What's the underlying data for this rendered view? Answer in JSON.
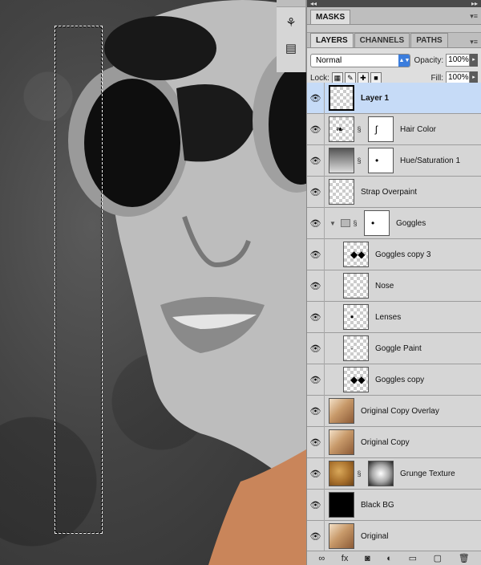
{
  "dock": {
    "top_arrows": "◂◂",
    "right_arrows": "▸▸",
    "menu_glyph": "▾≡"
  },
  "masks_panel": {
    "tab_label": "MASKS"
  },
  "layers_panel": {
    "tabs": [
      {
        "label": "LAYERS",
        "active": true
      },
      {
        "label": "CHANNELS",
        "active": false
      },
      {
        "label": "PATHS",
        "active": false
      }
    ],
    "blend_mode": "Normal",
    "opacity_label": "Opacity:",
    "opacity_value": "100%",
    "lock_label": "Lock:",
    "fill_label": "Fill:",
    "fill_value": "100%"
  },
  "layers": [
    {
      "name": "Layer 1",
      "selected": true,
      "thumb": "transparent",
      "mask": null,
      "indent": false
    },
    {
      "name": "Hair Color",
      "thumb": "transparent-brush",
      "mask": "white-hair",
      "indent": false
    },
    {
      "name": "Hue/Saturation 1",
      "thumb": "adjustment",
      "mask": "white-dot",
      "indent": false
    },
    {
      "name": "Strap Overpaint",
      "thumb": "transparent",
      "mask": null,
      "indent": false
    },
    {
      "name": "Goggles",
      "thumb": "folder",
      "mask": "white-dot",
      "indent": false,
      "group": true
    },
    {
      "name": "Goggles copy 3",
      "thumb": "transparent-goggles",
      "mask": null,
      "indent": true
    },
    {
      "name": "Nose",
      "thumb": "transparent",
      "mask": null,
      "indent": true
    },
    {
      "name": "Lenses",
      "thumb": "transparent-dot",
      "mask": null,
      "indent": true
    },
    {
      "name": "Goggle Paint",
      "thumb": "transparent-dot",
      "mask": null,
      "indent": true
    },
    {
      "name": "Goggles copy",
      "thumb": "transparent-goggles",
      "mask": null,
      "indent": true
    },
    {
      "name": "Original Copy Overlay",
      "thumb": "photo",
      "mask": null,
      "indent": false
    },
    {
      "name": "Original Copy",
      "thumb": "photo",
      "mask": null,
      "indent": false
    },
    {
      "name": "Grunge Texture",
      "thumb": "grunge",
      "mask": "radial",
      "indent": false
    },
    {
      "name": "Black BG",
      "thumb": "black",
      "mask": null,
      "indent": false
    },
    {
      "name": "Original",
      "thumb": "photo",
      "mask": null,
      "indent": false
    }
  ],
  "bottom_toolbar": [
    "link-icon",
    "fx-icon",
    "add-mask-icon",
    "adjustment-icon",
    "new-group-icon",
    "new-layer-icon",
    "trash-icon"
  ],
  "bottom_labels": {
    "link": "∞",
    "fx": "fx",
    "mask": "◙",
    "adjust": "◐",
    "group": "▭",
    "new": "▢",
    "trash": "🗑"
  }
}
